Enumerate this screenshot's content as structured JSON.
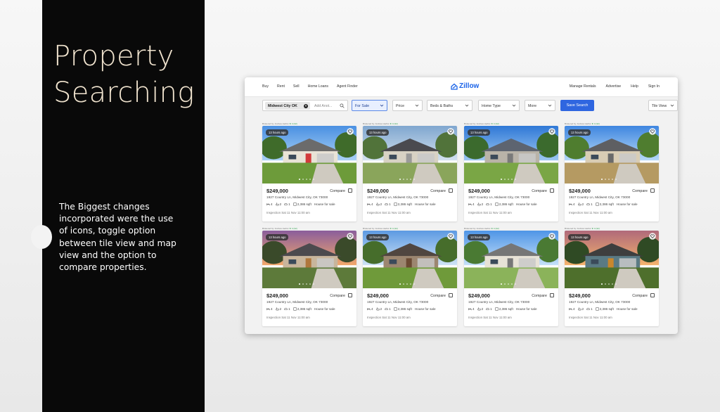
{
  "slide": {
    "title_line1": "Property",
    "title_line2": "Searching",
    "body": "The Biggest changes incorporated were the use of icons, toggle option between tile view and map view and the option to compare properties."
  },
  "nav": {
    "left": [
      "Buy",
      "Rent",
      "Sell",
      "Home Loans",
      "Agent Finder"
    ],
    "brand": "Zillow",
    "right": [
      "Manage Rentals",
      "Advertise",
      "Help",
      "Sign In"
    ]
  },
  "filters": {
    "location_chip": "Midwest City OK",
    "search_placeholder": "Add Anot...",
    "for_sale": "For Sale",
    "price": "Price",
    "beds_baths": "Beds & Baths",
    "home_type": "Home Type",
    "more": "More",
    "save_search": "Save Search",
    "view": "Tile View"
  },
  "colors": {
    "accent": "#2f66e0",
    "brand": "#1a63e8",
    "panel": "#090909",
    "title": "#f1e4cf"
  },
  "listings": [
    {
      "broker": "Brokered by: Andrew Herbst",
      "stars": "★ 4 (32)",
      "time": "13 hours ago",
      "price": "$249,000",
      "compare": "Compare",
      "address": "1927 Country Ln, Midwest City, OK 73000",
      "beds": "4",
      "baths": "2",
      "garage": "1",
      "sqft": "2,386 sqft",
      "status": "House for sale",
      "inspection": "Inspection Sat 11 Nov 11:00 am"
    },
    {
      "broker": "Brokered by: Andrew Herbst",
      "stars": "★ 4 (32)",
      "time": "13 hours ago",
      "price": "$249,000",
      "compare": "Compare",
      "address": "1927 Country Ln, Midwest City, OK 73000",
      "beds": "4",
      "baths": "2",
      "garage": "1",
      "sqft": "2,386 sqft",
      "status": "House for sale",
      "inspection": "Inspection Sat 11 Nov 11:00 am"
    },
    {
      "broker": "Brokered by: Andrew Herbst",
      "stars": "★ 4 (32)",
      "time": "13 hours ago",
      "price": "$249,000",
      "compare": "Compare",
      "address": "1927 Country Ln, Midwest City, OK 73000",
      "beds": "4",
      "baths": "2",
      "garage": "1",
      "sqft": "2,386 sqft",
      "status": "House for sale",
      "inspection": "Inspection Sat 11 Nov 11:00 am"
    },
    {
      "broker": "Brokered by: Andrew Herbst",
      "stars": "★ 4 (32)",
      "time": "13 hours ago",
      "price": "$249,000",
      "compare": "Compare",
      "address": "1927 Country Ln, Midwest City, OK 73000",
      "beds": "4",
      "baths": "2",
      "garage": "1",
      "sqft": "2,386 sqft",
      "status": "House for sale",
      "inspection": "Inspection Sat 11 Nov 11:00 am"
    },
    {
      "broker": "Brokered by: Andrew Herbst",
      "stars": "★ 4 (32)",
      "time": "13 hours ago",
      "price": "$249,000",
      "compare": "Compare",
      "address": "1927 Country Ln, Midwest City, OK 73000",
      "beds": "4",
      "baths": "2",
      "garage": "1",
      "sqft": "2,386 sqft",
      "status": "House for sale",
      "inspection": "Inspection Sat 11 Nov 11:00 am"
    },
    {
      "broker": "Brokered by: Andrew Herbst",
      "stars": "★ 4 (32)",
      "time": "13 hours ago",
      "price": "$249,000",
      "compare": "Compare",
      "address": "1927 Country Ln, Midwest City, OK 73000",
      "beds": "4",
      "baths": "2",
      "garage": "1",
      "sqft": "2,386 sqft",
      "status": "House for sale",
      "inspection": "Inspection Sat 11 Nov 11:00 am"
    },
    {
      "broker": "Brokered by: Andrew Herbst",
      "stars": "★ 4 (32)",
      "time": "13 hours ago",
      "price": "$249,000",
      "compare": "Compare",
      "address": "1927 Country Ln, Midwest City, OK 73000",
      "beds": "4",
      "baths": "2",
      "garage": "1",
      "sqft": "2,386 sqft",
      "status": "House for sale",
      "inspection": "Inspection Sat 11 Nov 11:00 am"
    },
    {
      "broker": "Brokered by: Andrew Herbst",
      "stars": "★ 4 (32)",
      "time": "13 hours ago",
      "price": "$249,000",
      "compare": "Compare",
      "address": "1927 Country Ln, Midwest City, OK 73000",
      "beds": "4",
      "baths": "2",
      "garage": "1",
      "sqft": "2,386 sqft",
      "status": "House for sale",
      "inspection": "Inspection Sat 11 Nov 11:00 am"
    }
  ]
}
